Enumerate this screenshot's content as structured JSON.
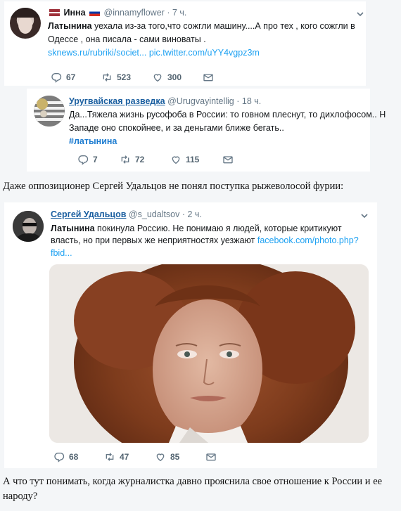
{
  "tweet1": {
    "name": "Инна",
    "handle": "@innamyflower",
    "time": "· 7 ч.",
    "text_bold": "Латынина",
    "text_line1": " уехала из-за того,что сожгли машину....А про тех , кого сожгли в",
    "text_line2": "Одессе , она писала - сами виноваты .",
    "link1": "sknews.ru/rubriki/societ...",
    "link2": "pic.twitter.com/uYY4vgpz3m",
    "replies": "67",
    "retweets": "523",
    "likes": "300"
  },
  "tweet2": {
    "name": "Уругвайская разведка",
    "handle": "@Urugvayintellig",
    "time": "· 18 ч.",
    "text_line1": "Да...Тяжела жизнь русофоба в России: то говном плеснут, то дихлофосом.. Н",
    "text_line2": "Западе оно спокойнее, и за деньгами ближе бегать..",
    "hashtag": "#латынина",
    "replies": "7",
    "retweets": "72",
    "likes": "115"
  },
  "caption1": "Даже оппозиционер Сергей Удальцов не понял поступка рыжеволосой фурии:",
  "tweet3": {
    "name": "Сергей Удальцов",
    "handle": "@s_udaltsov",
    "time": "· 2 ч.",
    "text_bold": "Латынина",
    "text_line1": " покинула Россию. Не  понимаю я людей, которые критикуют",
    "text_line2a": "власть, но при первых же неприятностях уезжают ",
    "link1": "facebook.com/photo.php?",
    "link2": "fbid...",
    "replies": "68",
    "retweets": "47",
    "likes": "85"
  },
  "caption2_line1": "А что тут понимать, когда журналистка давно прояснила свое отношение к России и ее",
  "caption2_line2": "народу?",
  "icons": [
    "reply-icon",
    "retweet-icon",
    "like-icon",
    "dm-icon",
    "chevron-down-icon"
  ],
  "colors": {
    "link": "#1da1f2",
    "name_link": "#1b5fa0",
    "muted": "#657786"
  }
}
